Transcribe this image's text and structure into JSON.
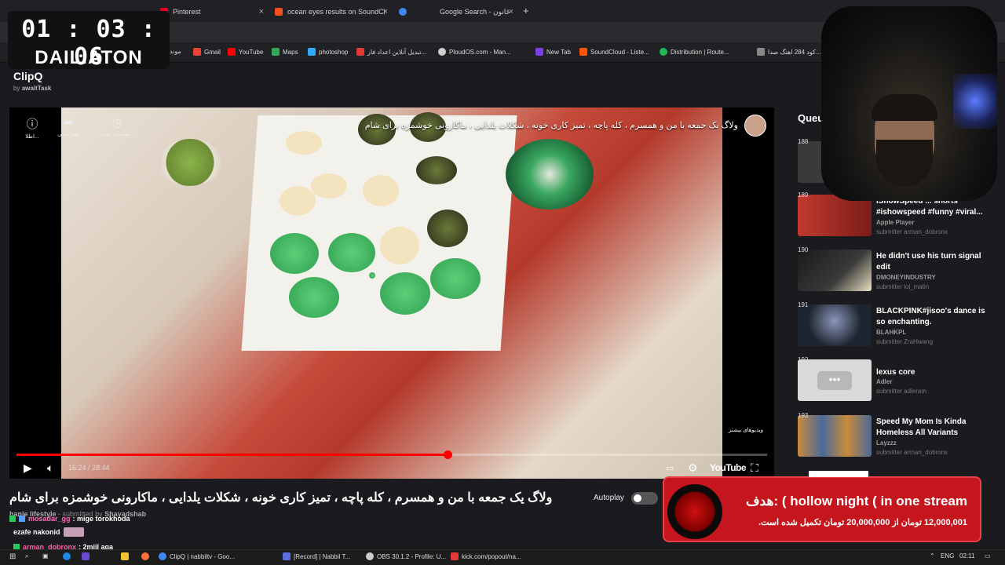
{
  "browser": {
    "tabs": [
      {
        "label": "Pinterest",
        "color": "#e60023"
      },
      {
        "label": "ocean eyes results on SoundCl",
        "color": "#f24e1e"
      },
      {
        "label": "",
        "color": "#4285f4"
      },
      {
        "label": "Google Search - ځاتون",
        "color": "#4285f4"
      }
    ],
    "bookmarks": [
      {
        "label": "Gmail",
        "color": "#ea4335"
      },
      {
        "label": "YouTube",
        "color": "#ff0000"
      },
      {
        "label": "Maps",
        "color": "#34a853"
      },
      {
        "label": "photoshop",
        "color": "#31a8ff"
      },
      {
        "label": "تبدیل آنلاین اعداد فار...",
        "color": "#e53935"
      },
      {
        "label": "PloudOS.com - Man...",
        "color": "#cfcfcf"
      },
      {
        "label": "New Tab",
        "color": "#7b3fe4"
      },
      {
        "label": "SoundCloud - Liste...",
        "color": "#ff5500"
      },
      {
        "label": "Distribution | Route...",
        "color": "#1db954"
      },
      {
        "label": "کود 284 اهنگ صدا...",
        "color": "#888888"
      }
    ],
    "bookmark_prefix": "موند"
  },
  "timer": {
    "digits": "01 : 03 : 06",
    "name": "DAILIATON"
  },
  "app": {
    "title": "ClipQ",
    "by_prefix": "by",
    "by_user": "awaitTask"
  },
  "player": {
    "video_title_overlay": "ولاگ یک جمعه با من و همسرم ، کله پاچه ، تمیز کاری خونه ، شکلات یلدایی ، ماکارونی خوشمزه برای شام",
    "top_controls": [
      {
        "icon": "info-icon",
        "glyph": "ⓘ",
        "label": "اطلا..."
      },
      {
        "icon": "share-icon",
        "glyph": "➦",
        "label": "هم‌رسانی"
      },
      {
        "icon": "watch-later-icon",
        "glyph": "◷",
        "label": "تماشای بعدی..."
      }
    ],
    "more_videos_label": "ویدیوهای بیشتر",
    "progress_fraction": 0.574,
    "time_current": "16:24",
    "time_total": "28:44",
    "time_display": "16:24 / 28:44",
    "youtube_label": "YouTube"
  },
  "below_player": {
    "title": "ولاگ یک جمعه با من و همسرم ، کله پاچه ، تمیز کاری خونه ، شکلات یلدایی ، ماکارونی خوشمزه برای شام",
    "autoplay_label": "Autoplay",
    "autoplay_on": false,
    "submitter_channel": "hanie lifestyle",
    "submitter_text": "- submitted by",
    "submitter_user": "Shayadshab"
  },
  "chat": [
    {
      "user": "mosadar_gg",
      "color": "#ff69b4",
      "message": ": mige torokhoda",
      "badges": 2
    },
    {
      "user": "",
      "color": "#ffffff",
      "message": "ezafe nakonid",
      "badges": 0,
      "emote": true
    },
    {
      "user": "arman_dobronx",
      "color": "#ff5fa2",
      "message": ": 2miil aqa",
      "badges": 1
    }
  ],
  "goal": {
    "title": "هدف: ( hollow night ( in one stream",
    "progress_text": "12,000,001 تومان از 20,000,000 تومان تکمیل شده است."
  },
  "queue": {
    "header": "Queue",
    "items": [
      {
        "num": "188",
        "title": "",
        "channel": "",
        "submitter": "",
        "thumb": "#3a3a3a"
      },
      {
        "num": "189",
        "title": "IShowSpeed ... shorts #ishowspeed #funny #viral...",
        "channel": "Apple Player",
        "submitter": "submitter arman_dobronx",
        "thumb": "#b5322a"
      },
      {
        "num": "190",
        "title": "He didn't use his turn signal edit",
        "channel": "DMONEYINDUSTRY",
        "submitter": "submitter lol_matin",
        "thumb": "#2b2b2b"
      },
      {
        "num": "191",
        "title": "BLACKPINK#jisoo's dance is so enchanting.",
        "channel": "BLAHKPL",
        "submitter": "submitter ZraHwang",
        "thumb": "#1e2430"
      },
      {
        "num": "192",
        "title": "lexus core",
        "channel": "Adler",
        "submitter": "submitter adleram",
        "thumb": "#d9d9d9"
      },
      {
        "num": "193",
        "title": "Speed My Mom Is Kinda Homeless All Variants",
        "channel": "Layzzz",
        "submitter": "submitter arman_dobronx",
        "thumb": "#c98a3a"
      }
    ]
  },
  "taskbar": {
    "items": [
      {
        "label": "ClipQ | nabbiltv - Goo...",
        "color": "#4285f4"
      },
      {
        "label": "[Record] | Nabbil T...",
        "color": "#5b6ee1"
      },
      {
        "label": "OBS 30.1.2 - Profile: U...",
        "color": "#cccccc"
      },
      {
        "label": "kick.com/popout/na...",
        "color": "#e53935"
      }
    ],
    "lang": "ENG",
    "clock": "02:11"
  }
}
